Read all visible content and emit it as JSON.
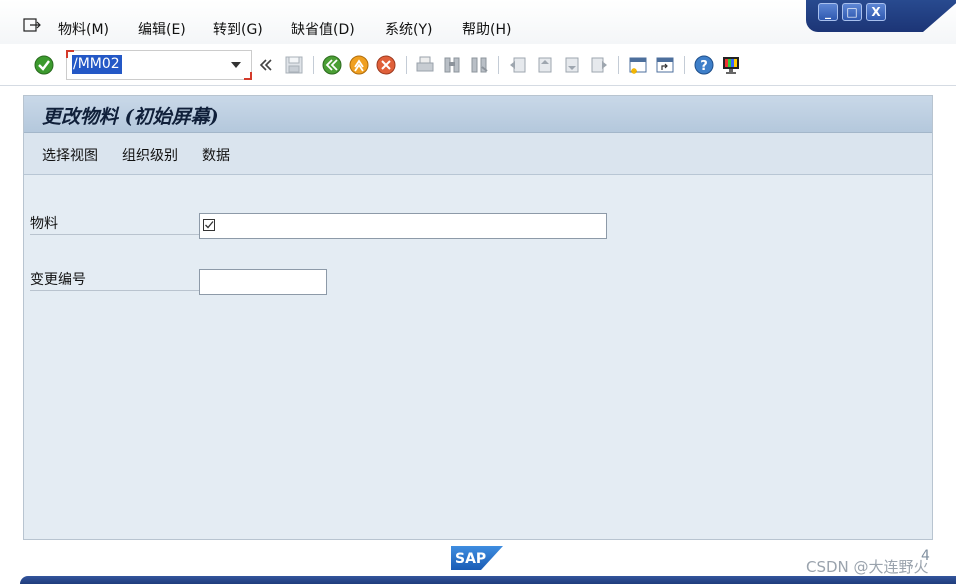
{
  "menu": {
    "items": [
      "物料(M)",
      "编辑(E)",
      "转到(G)",
      "缺省值(D)",
      "系统(Y)",
      "帮助(H)"
    ]
  },
  "window_controls": {
    "minimize": "_",
    "maximize": "□",
    "close": "X"
  },
  "toolbar": {
    "command_field_value": "/MM02"
  },
  "screen": {
    "title": "更改物料 (初始屏幕)",
    "app_toolbar": [
      "选择视图",
      "组织级别",
      "数据"
    ]
  },
  "form": {
    "material_label": "物料",
    "material_value": "",
    "change_number_label": "变更编号",
    "change_number_value": ""
  },
  "footer": {
    "logo_text": "SAP",
    "corner_number": "4",
    "watermark": "CSDN @大连野火"
  },
  "colors": {
    "accent": "#2458c6",
    "frame_background": "#e4ecf3",
    "title_bar": "#b4c8dc",
    "window_controls": "#1c3576"
  }
}
